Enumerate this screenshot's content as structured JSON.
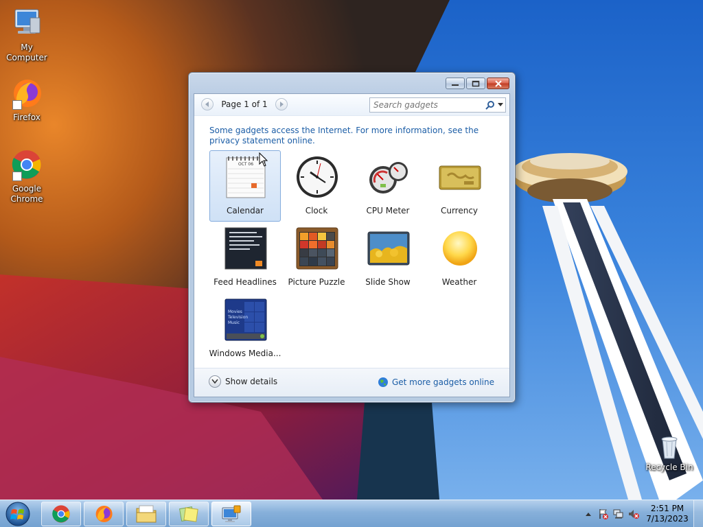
{
  "desktop": {
    "icons": [
      {
        "label": "My Computer",
        "icon": "computer-icon"
      },
      {
        "label": "Firefox",
        "icon": "firefox-icon"
      },
      {
        "label": "Google Chrome",
        "icon": "chrome-icon"
      },
      {
        "label": "Recycle Bin",
        "icon": "recycle-bin-icon"
      }
    ]
  },
  "gadget_window": {
    "pager": {
      "label": "Page 1 of 1"
    },
    "search": {
      "placeholder": "Search gadgets"
    },
    "notice": "Some gadgets access the Internet.  For more information, see the privacy statement online.",
    "gadgets": [
      {
        "label": "Calendar",
        "icon": "calendar-icon",
        "selected": true
      },
      {
        "label": "Clock",
        "icon": "clock-icon"
      },
      {
        "label": "CPU Meter",
        "icon": "cpu-meter-icon"
      },
      {
        "label": "Currency",
        "icon": "currency-icon"
      },
      {
        "label": "Feed Headlines",
        "icon": "feed-headlines-icon"
      },
      {
        "label": "Picture Puzzle",
        "icon": "picture-puzzle-icon"
      },
      {
        "label": "Slide Show",
        "icon": "slide-show-icon"
      },
      {
        "label": "Weather",
        "icon": "weather-icon"
      },
      {
        "label": "Windows Media...",
        "icon": "windows-media-center-icon"
      }
    ],
    "calendar_thumb": {
      "month": "OCT 06"
    },
    "media_thumb": {
      "items": [
        "Movies",
        "Television",
        "Music"
      ]
    },
    "footer": {
      "show_details": "Show details",
      "get_more": "Get more gadgets online"
    }
  },
  "taskbar": {
    "pinned": [
      {
        "icon": "chrome-icon"
      },
      {
        "icon": "firefox-icon"
      },
      {
        "icon": "file-explorer-icon"
      },
      {
        "icon": "sticky-notes-icon"
      },
      {
        "icon": "gadgets-icon",
        "active": true
      }
    ],
    "clock": {
      "time": "2:51 PM",
      "date": "7/13/2023"
    }
  },
  "colors": {
    "link": "#1b5da6",
    "selection": "#cfe1f6",
    "taskbar": "#8cb4dc"
  }
}
